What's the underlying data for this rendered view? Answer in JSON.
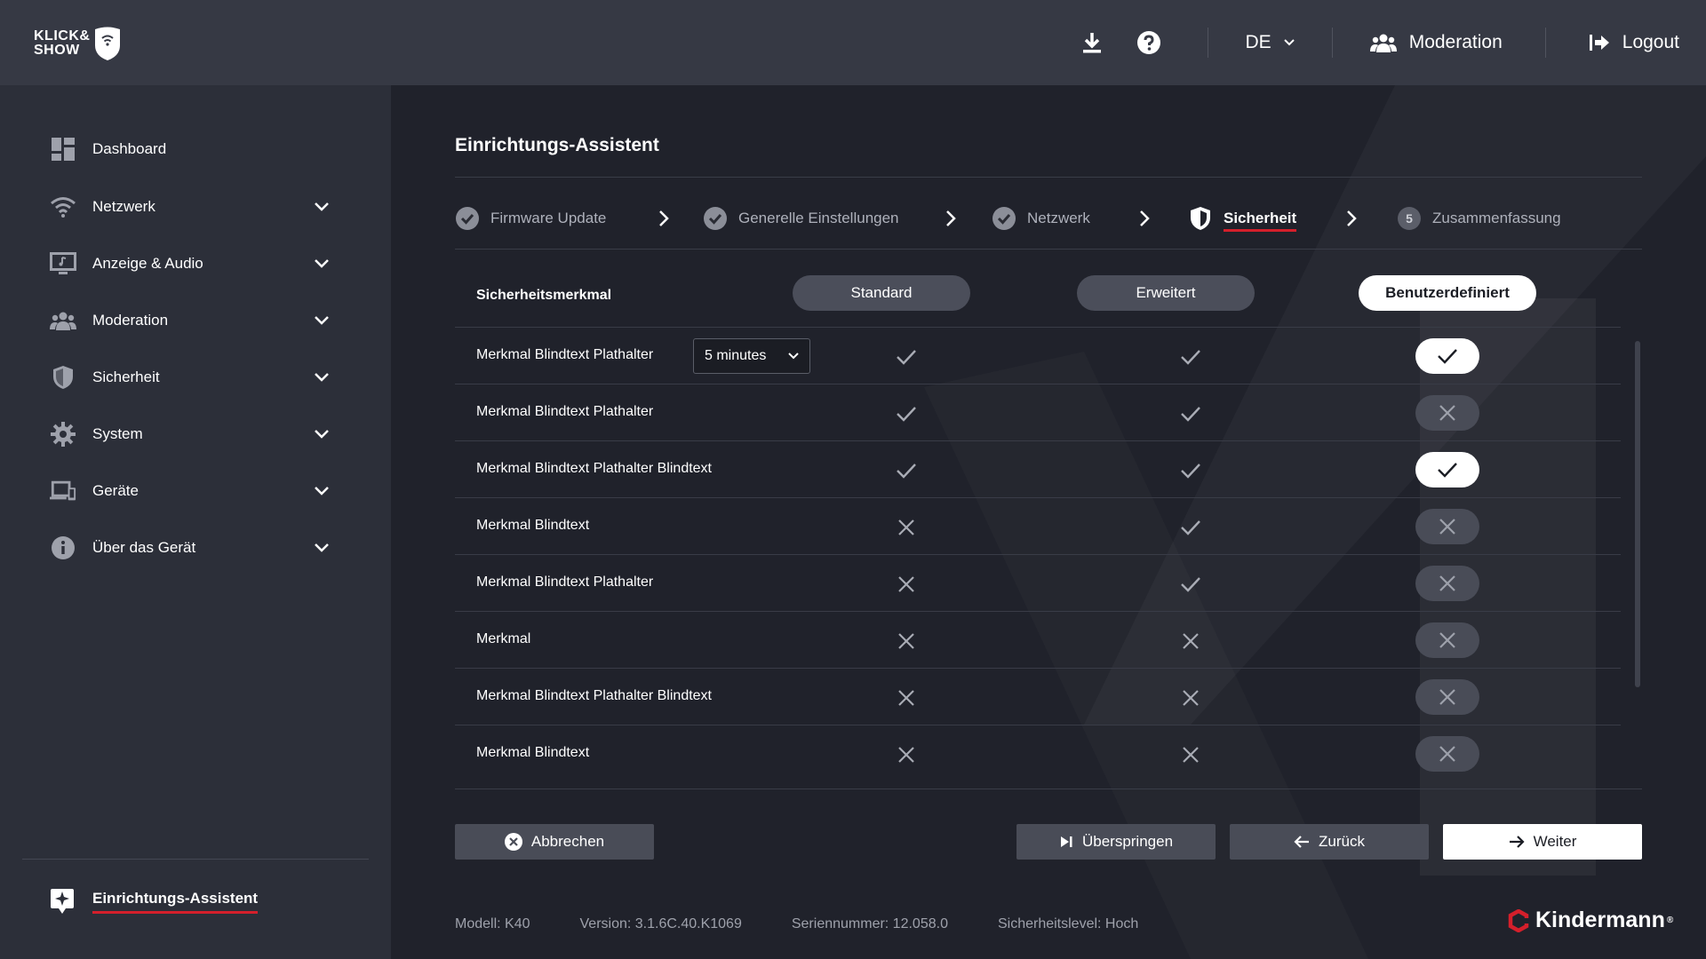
{
  "header": {
    "logo": {
      "line1": "KLICK&",
      "line2": "SHOW"
    },
    "language": "DE",
    "moderation_label": "Moderation",
    "logout_label": "Logout"
  },
  "sidebar": {
    "items": [
      {
        "label": "Dashboard",
        "icon": "dashboard-icon"
      },
      {
        "label": "Netzwerk",
        "icon": "wifi-icon"
      },
      {
        "label": "Anzeige & Audio",
        "icon": "monitor-audio-icon"
      },
      {
        "label": "Moderation",
        "icon": "users-icon"
      },
      {
        "label": "Sicherheit",
        "icon": "shield-icon"
      },
      {
        "label": "System",
        "icon": "gear-icon"
      },
      {
        "label": "Geräte",
        "icon": "devices-icon"
      },
      {
        "label": "Über das Gerät",
        "icon": "info-icon"
      }
    ],
    "wizard_label": "Einrichtungs-Assistent"
  },
  "main": {
    "title": "Einrichtungs-Assistent",
    "steps": [
      {
        "label": "Firmware Update",
        "state": "done"
      },
      {
        "label": "Generelle Einstellungen",
        "state": "done"
      },
      {
        "label": "Netzwerk",
        "state": "done"
      },
      {
        "label": "Sicherheit",
        "state": "active"
      },
      {
        "label": "Zusammenfassung",
        "state": "pending",
        "number": "5"
      }
    ],
    "table": {
      "header_label": "Sicherheitsmerkmal",
      "presets": [
        "Standard",
        "Erweitert",
        "Benutzerdefiniert"
      ],
      "selected_preset": "Benutzerdefiniert",
      "dropdown_value": "5 minutes",
      "rows": [
        {
          "label": "Merkmal Blindtext Plathalter",
          "standard": true,
          "erweitert": true,
          "custom": true
        },
        {
          "label": "Merkmal Blindtext Plathalter",
          "standard": true,
          "erweitert": true,
          "custom": false
        },
        {
          "label": "Merkmal Blindtext Plathalter Blindtext",
          "standard": true,
          "erweitert": true,
          "custom": true
        },
        {
          "label": "Merkmal Blindtext",
          "standard": false,
          "erweitert": true,
          "custom": false
        },
        {
          "label": "Merkmal Blindtext Plathalter",
          "standard": false,
          "erweitert": true,
          "custom": false
        },
        {
          "label": "Merkmal",
          "standard": false,
          "erweitert": false,
          "custom": false
        },
        {
          "label": "Merkmal Blindtext Plathalter Blindtext",
          "standard": false,
          "erweitert": false,
          "custom": false
        },
        {
          "label": "Merkmal Blindtext",
          "standard": false,
          "erweitert": false,
          "custom": false
        }
      ]
    },
    "buttons": {
      "cancel": "Abbrechen",
      "skip": "Überspringen",
      "back": "Zurück",
      "next": "Weiter"
    },
    "footer": {
      "model": "Modell: K40",
      "version": "Version: 3.1.6C.40.K1069",
      "serial": "Seriennummer: 12.058.0",
      "security": "Sicherheitslevel: Hoch"
    },
    "brand": "Kindermann"
  },
  "colors": {
    "accent_red": "#d41f2b",
    "header_bg": "#363944",
    "sidebar_bg": "#2c2f39",
    "main_bg": "#20222b"
  }
}
